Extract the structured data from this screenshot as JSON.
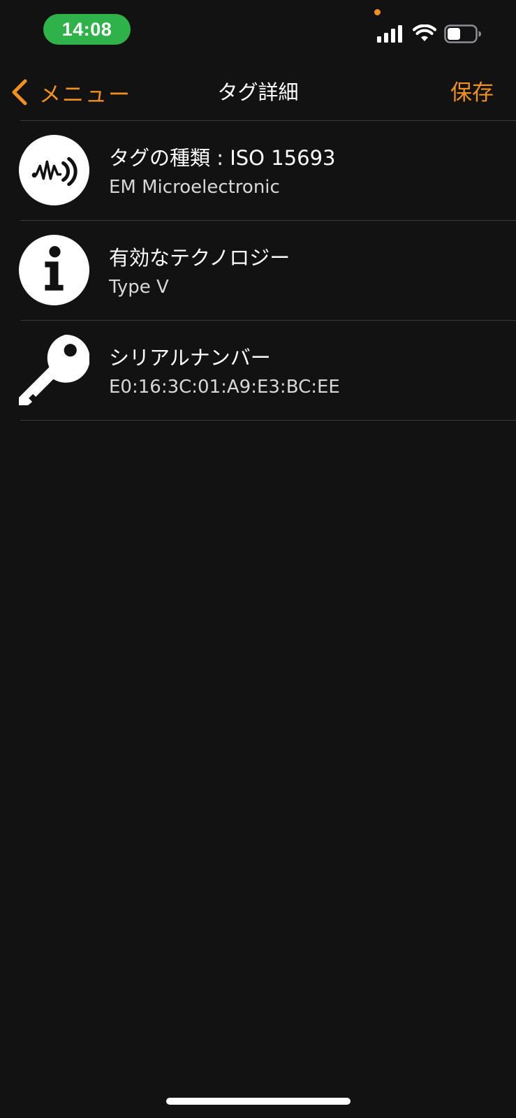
{
  "status_bar": {
    "time": "14:08",
    "time_pill_color": "#30b24a",
    "privacy_dot_color": "#f0901e",
    "icons": [
      "signal-icon",
      "wifi-icon",
      "battery-icon"
    ]
  },
  "nav": {
    "back_label": "メニュー",
    "title": "タグ詳細",
    "save_label": "保存",
    "accent_color": "#f0901e"
  },
  "items": [
    {
      "icon": "nfc-wave-icon",
      "title": "タグの種類 : ISO 15693",
      "value": "EM Microelectronic"
    },
    {
      "icon": "info-icon",
      "title": "有効なテクノロジー",
      "value": "Type V"
    },
    {
      "icon": "key-icon",
      "title": "シリアルナンバー",
      "value": "E0:16:3C:01:A9:E3:BC:EE"
    }
  ]
}
